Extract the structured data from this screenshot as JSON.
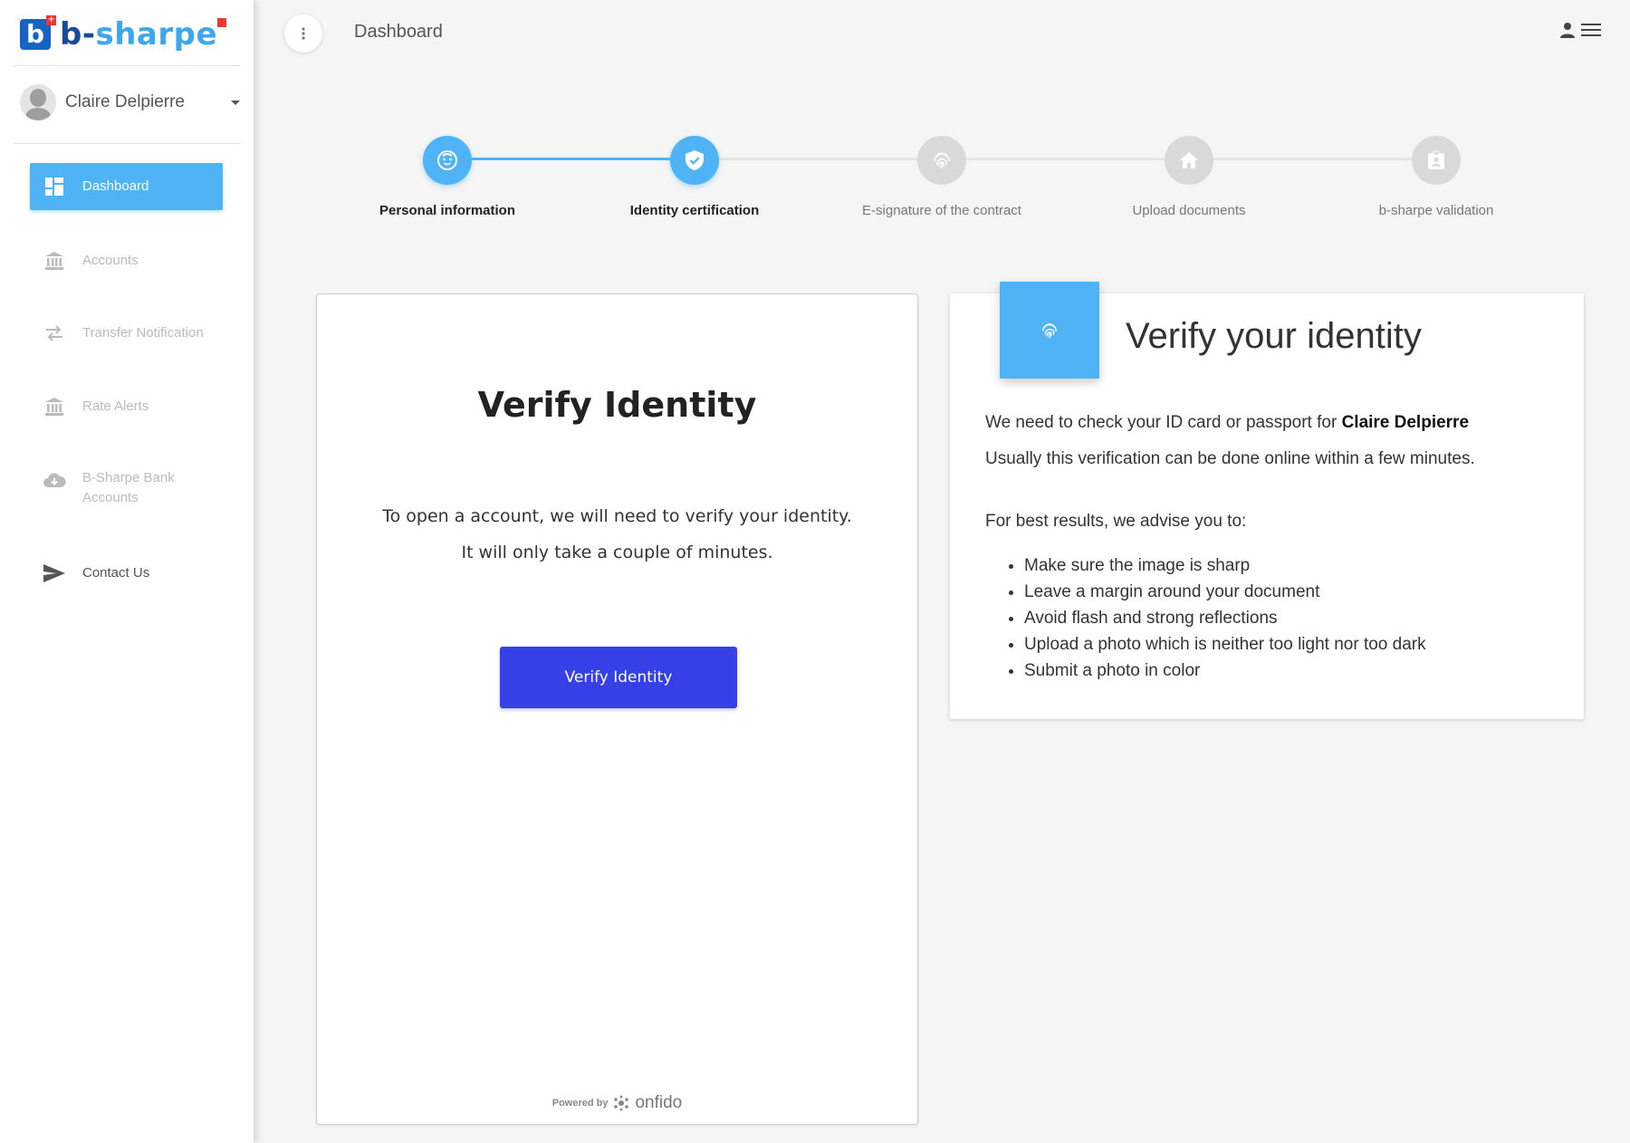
{
  "brand": {
    "logo_letter": "b",
    "name_part1": "b-",
    "name_part2": "sharpe",
    "flag_symbol": "+"
  },
  "user": {
    "name": "Claire Delpierre"
  },
  "sidebar": {
    "items": [
      {
        "label": "Dashboard",
        "icon": "dashboard-icon",
        "state": "active"
      },
      {
        "label": "Accounts",
        "icon": "bank-icon",
        "state": "muted"
      },
      {
        "label": "Transfer Notification",
        "icon": "transfer-arrows-icon",
        "state": "muted"
      },
      {
        "label": "Rate Alerts",
        "icon": "bank-icon",
        "state": "muted"
      },
      {
        "label_line1": "B-Sharpe Bank",
        "label_line2": "Accounts",
        "icon": "cloud-download-icon",
        "state": "muted"
      },
      {
        "label": "Contact Us",
        "icon": "send-icon",
        "state": "normal"
      }
    ]
  },
  "topbar": {
    "title": "Dashboard"
  },
  "stepper": {
    "steps": [
      {
        "label": "Personal information",
        "icon": "face-icon",
        "state": "active"
      },
      {
        "label": "Identity certification",
        "icon": "shield-check-icon",
        "state": "active"
      },
      {
        "label": "E-signature of the contract",
        "icon": "fingerprint-icon",
        "state": "inactive"
      },
      {
        "label": "Upload documents",
        "icon": "home-icon",
        "state": "inactive"
      },
      {
        "label": "b-sharpe validation",
        "icon": "badge-icon",
        "state": "inactive"
      }
    ]
  },
  "verify_card": {
    "title": "Verify Identity",
    "desc_line1": "To open a account, we will need to verify your identity.",
    "desc_line2": "It will only take a couple of minutes.",
    "button_label": "Verify Identity",
    "powered_by": "Powered by",
    "provider": "onfido"
  },
  "info_card": {
    "title": "Verify your identity",
    "line1_prefix": "We need to check your ID card or passport for ",
    "line1_name": "Claire Delpierre",
    "line2": "Usually this verification can be done online within a few minutes.",
    "advice_intro": "For best results, we advise you to:",
    "tips": [
      "Make sure the image is sharp",
      "Leave a margin around your document",
      "Avoid flash and strong reflections",
      "Upload a photo which is neither too light nor too dark",
      "Submit a photo in color"
    ]
  },
  "colors": {
    "accent": "#4fb3f6",
    "primary_button": "#3541e6",
    "brand_dark": "#1a4b9b",
    "flag_red": "#e53935"
  }
}
